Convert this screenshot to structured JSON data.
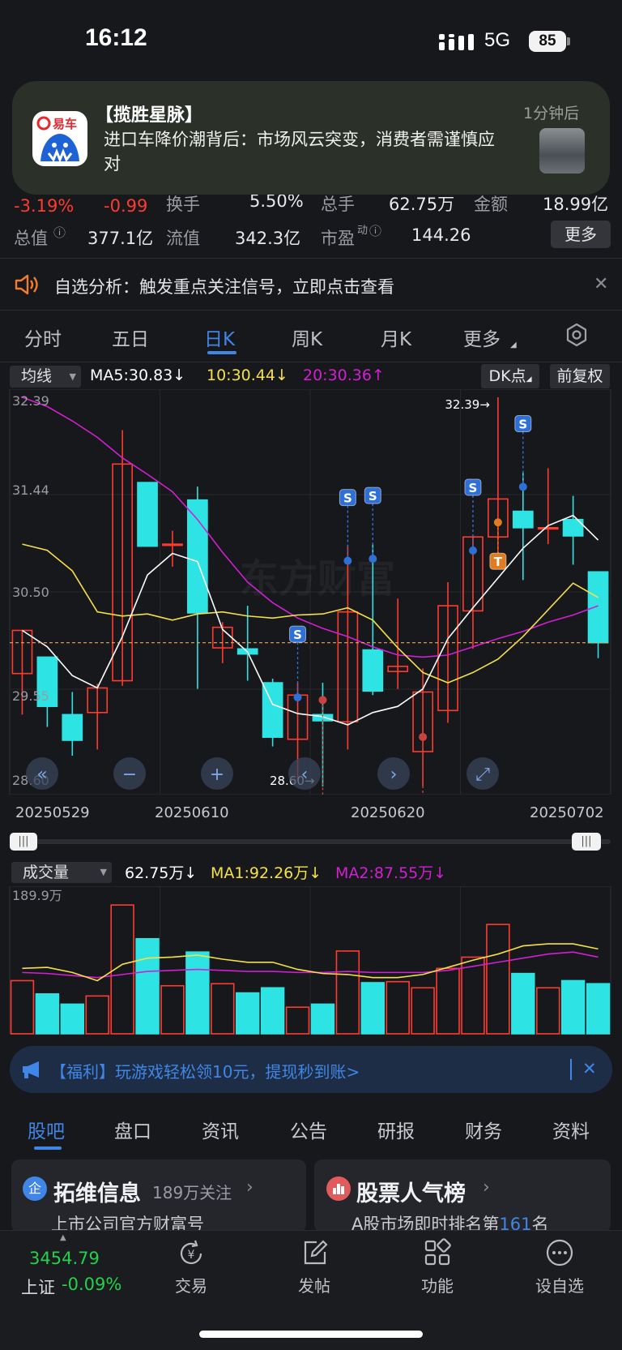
{
  "status_bar": {
    "time": "16:12",
    "network": "5G",
    "battery": "85"
  },
  "notification": {
    "app_icon_text": "易车",
    "title": "【揽胜星脉】",
    "body": "进口车降价潮背后：市场风云突变，消费者需谨慎应对",
    "time": "1分钟后"
  },
  "quote": {
    "change_pct": "-3.19%",
    "change": "-0.99",
    "turnover_label": "换手",
    "turnover": "5.50%",
    "volume_label": "总手",
    "volume": "62.75万",
    "amount_label": "金额",
    "amount": "18.99亿",
    "mktcap_label": "总值",
    "mktcap": "377.1亿",
    "float_label": "流值",
    "float": "342.3亿",
    "pe_label": "市盈",
    "pe_sup": "动",
    "pe": "144.26",
    "more_label": "更多"
  },
  "alert": {
    "text": "自选分析：触发重点关注信号，立即点击查看"
  },
  "chart_tabs": [
    "分时",
    "五日",
    "日K",
    "周K",
    "月K",
    "更多"
  ],
  "active_chart_tab": "日K",
  "ma_bar": {
    "selector": "均线",
    "ma5": "MA5:30.83",
    "ma10": "10:30.44",
    "ma20": "20:30.36",
    "dk": "DK点",
    "adjust": "前复权"
  },
  "colors": {
    "up": "#ff3b30",
    "down": "#2ee3e3",
    "ma5": "#ffffff",
    "ma10": "#f5e04a",
    "ma20": "#d21fd2",
    "accent": "#3f86e6"
  },
  "price_axis": {
    "top": "32.39",
    "l2": "31.44",
    "l3": "30.50",
    "l4": "29.55",
    "bottom": "28.60"
  },
  "high_marker": "32.39→",
  "low_marker": "28.60→",
  "date_labels": [
    "20250529",
    "20250610",
    "20250620",
    "20250702"
  ],
  "volume_bar": {
    "selector": "成交量",
    "vol": "62.75万",
    "ma1": "MA1:92.26万",
    "ma2": "MA2:87.55万",
    "axis_max": "189.9万"
  },
  "chart_data": {
    "type": "candlestick",
    "ylim": [
      28.6,
      32.39
    ],
    "candles": [
      {
        "o": 29.7,
        "h": 30.12,
        "l": 29.3,
        "c": 30.12
      },
      {
        "o": 29.86,
        "h": 29.86,
        "l": 29.18,
        "c": 29.38
      },
      {
        "o": 29.3,
        "h": 29.52,
        "l": 28.9,
        "c": 29.05
      },
      {
        "o": 29.32,
        "h": 29.6,
        "l": 28.96,
        "c": 29.56
      },
      {
        "o": 29.63,
        "h": 32.07,
        "l": 29.58,
        "c": 31.74
      },
      {
        "o": 31.56,
        "h": 31.56,
        "l": 30.98,
        "c": 30.94
      },
      {
        "o": 30.95,
        "h": 31.09,
        "l": 30.74,
        "c": 30.96
      },
      {
        "o": 31.39,
        "h": 31.52,
        "l": 29.55,
        "c": 30.29
      },
      {
        "o": 29.95,
        "h": 30.2,
        "l": 29.8,
        "c": 30.15
      },
      {
        "o": 29.94,
        "h": 30.36,
        "l": 29.63,
        "c": 29.89
      },
      {
        "o": 29.61,
        "h": 29.65,
        "l": 28.99,
        "c": 29.08
      },
      {
        "o": 29.06,
        "h": 29.61,
        "l": 28.66,
        "c": 29.49
      },
      {
        "o": 29.3,
        "h": 29.61,
        "l": 28.6,
        "c": 29.24
      },
      {
        "o": 29.23,
        "h": 30.94,
        "l": 28.96,
        "c": 30.3
      },
      {
        "o": 29.93,
        "h": 30.96,
        "l": 29.49,
        "c": 29.53
      },
      {
        "o": 29.72,
        "h": 30.43,
        "l": 29.55,
        "c": 29.77
      },
      {
        "o": 28.94,
        "h": 29.75,
        "l": 28.6,
        "c": 29.52
      },
      {
        "o": 29.34,
        "h": 30.59,
        "l": 29.22,
        "c": 30.36
      },
      {
        "o": 30.31,
        "h": 31.04,
        "l": 29.94,
        "c": 31.03
      },
      {
        "o": 31.03,
        "h": 32.39,
        "l": 30.86,
        "c": 31.4
      },
      {
        "o": 31.28,
        "h": 31.66,
        "l": 30.61,
        "c": 31.12
      },
      {
        "o": 31.11,
        "h": 31.7,
        "l": 30.96,
        "c": 31.12
      },
      {
        "o": 31.2,
        "h": 31.43,
        "l": 30.76,
        "c": 31.04
      },
      {
        "o": 30.69,
        "h": 30.69,
        "l": 29.85,
        "c": 30.0
      }
    ],
    "ma5": [
      30.12,
      29.96,
      29.68,
      29.56,
      30.06,
      30.66,
      30.87,
      30.79,
      30.13,
      29.91,
      29.4,
      29.31,
      29.28,
      29.2,
      29.32,
      29.38,
      29.55,
      30.04,
      30.34,
      30.63,
      30.92,
      31.14,
      31.24,
      31.0
    ],
    "ma10": [
      30.96,
      30.9,
      30.7,
      30.3,
      30.26,
      30.28,
      30.22,
      30.28,
      30.3,
      30.26,
      30.24,
      30.27,
      30.28,
      30.34,
      30.22,
      29.95,
      29.71,
      29.61,
      29.71,
      29.84,
      30.06,
      30.32,
      30.58,
      30.44
    ],
    "ma20": [
      32.39,
      32.3,
      32.16,
      32.0,
      31.8,
      31.64,
      31.47,
      31.2,
      30.88,
      30.59,
      30.39,
      30.24,
      30.14,
      30.06,
      29.96,
      29.88,
      29.86,
      29.88,
      29.96,
      30.04,
      30.11,
      30.2,
      30.27,
      30.36
    ],
    "volume": [
      52,
      39,
      29,
      37,
      126,
      93,
      47,
      80,
      49,
      40,
      45,
      26,
      29,
      81,
      50,
      51,
      45,
      64,
      75,
      107,
      59,
      45,
      52,
      49
    ],
    "vol_ma1": [
      64,
      65,
      60,
      52,
      68,
      74,
      75,
      77,
      73,
      70,
      70,
      63,
      59,
      58,
      55,
      55,
      58,
      65,
      72,
      78,
      86,
      88,
      88,
      83
    ],
    "vol_ma2": [
      60,
      59,
      57,
      55,
      58,
      61,
      62,
      63,
      62,
      61,
      61,
      60,
      60,
      61,
      60,
      60,
      60,
      62,
      66,
      70,
      74,
      78,
      80,
      75
    ],
    "signals": [
      {
        "i": 11,
        "label": "S"
      },
      {
        "i": 13,
        "label": "S"
      },
      {
        "i": 14,
        "label": "S"
      },
      {
        "i": 18,
        "label": "S"
      },
      {
        "i": 20,
        "label": "S"
      },
      {
        "i": 12,
        "label": "B"
      },
      {
        "i": 16,
        "label": "B"
      },
      {
        "i": 19,
        "label": "T"
      }
    ]
  },
  "promo": {
    "text": "【福利】玩游戏轻松领10元，提现秒到账>"
  },
  "bottom_tabs": [
    "股吧",
    "盘口",
    "资讯",
    "公告",
    "研报",
    "财务",
    "资料"
  ],
  "active_bottom_tab": "股吧",
  "cards": [
    {
      "icon": "企",
      "title": "拓维信息",
      "meta": "189万关注",
      "sub": "上市公司官方财富号"
    },
    {
      "title": "股票人气榜",
      "sub_prefix": "A股市场即时排名第",
      "rank": "161",
      "sub_suffix": "名"
    }
  ],
  "index": {
    "value": "3454.79",
    "name": "上证",
    "change": "-0.09%"
  },
  "nav": [
    "交易",
    "发帖",
    "功能",
    "设自选"
  ]
}
